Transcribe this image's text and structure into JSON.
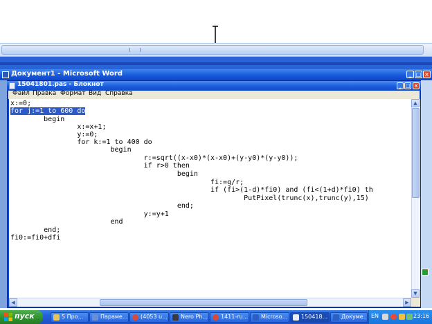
{
  "word": {
    "title": "Документ1 - Microsoft Word"
  },
  "notepad": {
    "title": "15041801.pas - Блокнот",
    "menu": [
      "Файл",
      "Правка",
      "Формат",
      "Вид",
      "Справка"
    ],
    "code_lines": [
      "x:=0;",
      "for j:=1 to 600 do",
      "        begin",
      "                x:=x+1;",
      "                y:=0;",
      "                for k:=1 to 400 do",
      "                        begin",
      "                                r:=sqrt((x-x0)*(x-x0)+(y-y0)*(y-y0));",
      "                                if r>0 then",
      "                                        begin",
      "                                                fi:=g/r;",
      "                                                if (fi>(1-d)*fi0) and (fi<(1+d)*fi0) th",
      "                                                        PutPixel(trunc(x),trunc(y),15)",
      "                                        end;",
      "                                y:=y+1",
      "                        end",
      "        end;",
      "fi0:=fi0+dfi"
    ],
    "selected_line": "for j:=1 to 600 do"
  },
  "taskbar": {
    "start_label": "пуск",
    "items": [
      {
        "label": "5 Про...",
        "icon_color": "#e8c35a"
      },
      {
        "label": "Параме...",
        "icon_color": "#6a8fd6"
      },
      {
        "label": "(4053 u...",
        "icon_color": "#d84a3a"
      },
      {
        "label": "Nero Ph...",
        "icon_color": "#3a3a3a"
      },
      {
        "label": "1411-ru...",
        "icon_color": "#d84a3a"
      },
      {
        "label": "Microso...",
        "icon_color": "#2b5fc4"
      },
      {
        "label": "150418...",
        "icon_color": "#e9eef7"
      },
      {
        "label": "Докуме...",
        "icon_color": "#2b5fc4"
      }
    ],
    "tray": {
      "language": "EN",
      "time": "23:16"
    }
  }
}
